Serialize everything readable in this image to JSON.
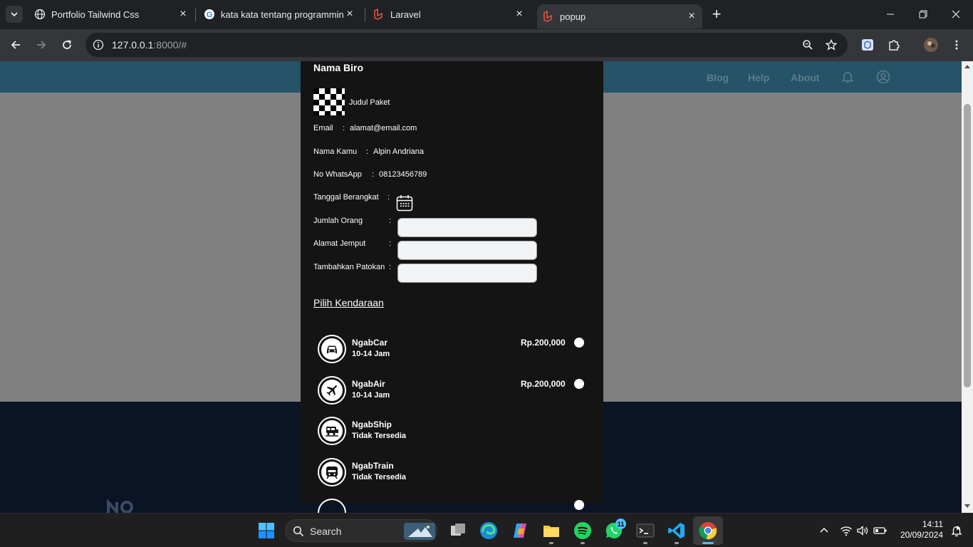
{
  "browser": {
    "tabs": [
      {
        "title": "Portfolio Tailwind Css",
        "icon": "globe-icon"
      },
      {
        "title": "kata kata tentang programming",
        "icon": "google-icon"
      },
      {
        "title": "Laravel",
        "icon": "laravel-icon"
      },
      {
        "title": "popup",
        "icon": "laravel-icon",
        "active": true
      }
    ],
    "url_host": "127.0.0.1",
    "url_rest": ":8000/#"
  },
  "site_nav": {
    "links": [
      "Blog",
      "Help",
      "About"
    ]
  },
  "popup": {
    "biro": "Nama Biro",
    "judul": "Judul Paket",
    "rows": [
      {
        "label": "Email",
        "value": "alamat@email.com"
      },
      {
        "label": "Nama Kamu",
        "value": "Alpin Andriana"
      },
      {
        "label": "No WhatsApp",
        "value": "08123456789"
      }
    ],
    "colon": ":",
    "tanggal_label": "Tanggal Berangkat",
    "jumlah_label": "Jumlah Orang",
    "alamat_label": "Alamat Jemput",
    "patokan_label": "Tambahkan Patokan",
    "jumlah_value": "",
    "alamat_value": "",
    "patokan_value": "",
    "pilih_label": "Pilih Kendaraan",
    "vehicles": [
      {
        "name": "NgabCar",
        "sub": "10-14 Jam",
        "price": "Rp.200,000",
        "icon": "car-icon",
        "available": true
      },
      {
        "name": "NgabAir",
        "sub": "10-14 Jam",
        "price": "Rp.200,000",
        "icon": "airplane-icon",
        "available": true
      },
      {
        "name": "NgabShip",
        "sub": "Tidak Tersedia",
        "price": "",
        "icon": "ship-icon",
        "available": false
      },
      {
        "name": "NgabTrain",
        "sub": "Tidak Tersedia",
        "price": "",
        "icon": "train-icon",
        "available": false
      }
    ]
  },
  "taskbar": {
    "search_label": "Search",
    "whatsapp_badge": "11",
    "time": "14:11",
    "date": "20/09/2024"
  },
  "colors": {
    "nav_bg": "#255368",
    "page_bg": "#808080",
    "popup_bg": "#141414",
    "footer_bg": "#0b1424"
  }
}
